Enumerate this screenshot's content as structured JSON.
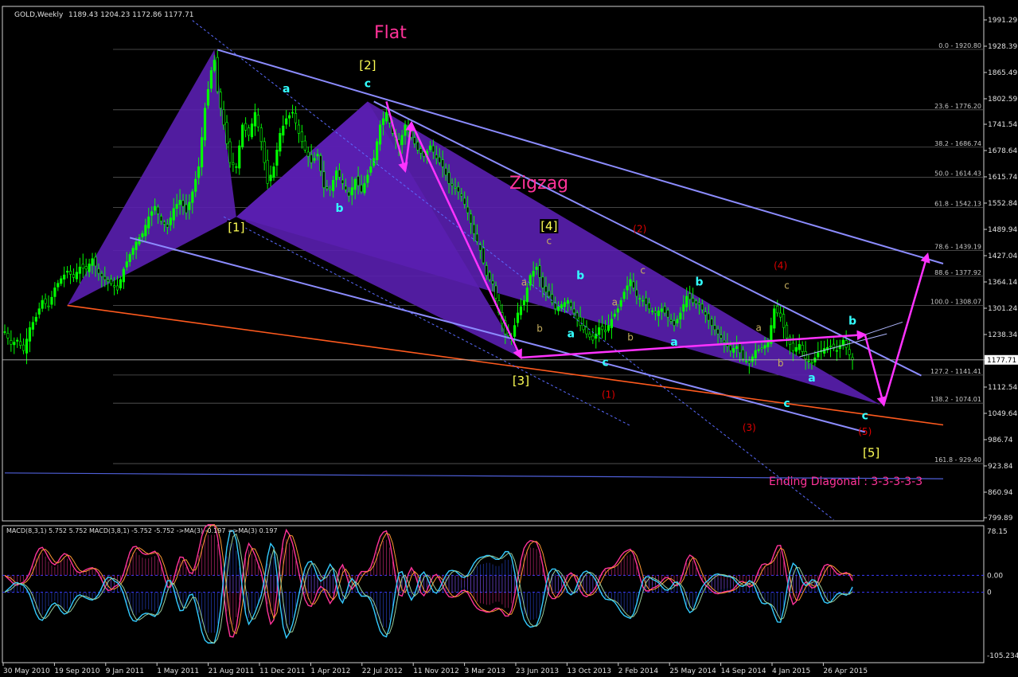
{
  "header": {
    "symbol": "GOLD,Weekly",
    "ohlc": "1189.43 1204.23 1172.86 1177.71"
  },
  "annotations": {
    "flat_title": "Flat",
    "zigzag_title": "Zigzag",
    "ending_diagonal": "Ending Diagonal : 3-3-3-3-3"
  },
  "colors": {
    "background": "#000000",
    "bull_candle": "#00ff00",
    "grid": "#5a5a5a",
    "pattern_fill": "#5a1fb0",
    "channel": "#8c8cff",
    "arrow": "#ff33ff",
    "support": "#ff5a1e",
    "label_yellow": "#ffff55",
    "label_cyan": "#33ffff",
    "label_red": "#e00000",
    "label_tan": "#c8b060",
    "macd_pink": "#ff3399",
    "macd_cyan": "#33ccff"
  },
  "chart_data": [
    {
      "type": "candlestick",
      "title": "GOLD,Weekly",
      "ylim": [
        799.89,
        1991.29
      ],
      "price_ticks": [
        "1991.29",
        "1928.39",
        "1865.49",
        "1802.59",
        "1741.54",
        "1678.64",
        "1615.74",
        "1552.84",
        "1489.94",
        "1427.04",
        "1364.14",
        "1301.24",
        "1238.34",
        "1177.71",
        "1112.54",
        "1049.64",
        "986.74",
        "923.84",
        "860.94",
        "799.89"
      ],
      "x_labels": [
        "30 May 2010",
        "19 Sep 2010",
        "9 Jan 2011",
        "1 May 2011",
        "21 Aug 2011",
        "11 Dec 2011",
        "1 Apr 2012",
        "22 Jul 2012",
        "11 Nov 2012",
        "3 Mar 2013",
        "23 Jun 2013",
        "13 Oct 2013",
        "2 Feb 2014",
        "25 May 2014",
        "14 Sep 2014",
        "4 Jan 2015",
        "26 Apr 2015"
      ],
      "last_price": "1177.71",
      "fibonacci_levels": [
        {
          "ratio": "0.0",
          "price": 1920.8,
          "label": "0.0 - 1920.80"
        },
        {
          "ratio": "23.6",
          "price": 1776.2,
          "label": "23.6 - 1776.20"
        },
        {
          "ratio": "38.2",
          "price": 1686.74,
          "label": "38.2 - 1686.74"
        },
        {
          "ratio": "50.0",
          "price": 1614.43,
          "label": "50.0 - 1614.43"
        },
        {
          "ratio": "61.8",
          "price": 1542.13,
          "label": "61.8 - 1542.13"
        },
        {
          "ratio": "78.6",
          "price": 1439.19,
          "label": "78.6 - 1439.19"
        },
        {
          "ratio": "88.6",
          "price": 1377.92,
          "label": "88.6 - 1377.92"
        },
        {
          "ratio": "100.0",
          "price": 1308.07,
          "label": "100.0 - 1308.07"
        },
        {
          "ratio": "127.2",
          "price": 1141.41,
          "label": "127.2 - 1141.41"
        },
        {
          "ratio": "138.2",
          "price": 1074.01,
          "label": "138.2 - 1074.01"
        },
        {
          "ratio": "161.8",
          "price": 929.4,
          "label": "161.8 - 929.40"
        }
      ],
      "wave_labels": [
        {
          "text": "[1]",
          "week": 74,
          "price": 1485,
          "color": "yellow"
        },
        {
          "text": "[2]",
          "week": 116,
          "price": 1873,
          "color": "yellow"
        },
        {
          "text": "[3]",
          "week": 165,
          "price": 1118,
          "color": "yellow"
        },
        {
          "text": "[4]",
          "week": 174,
          "price": 1488,
          "color": "yellow"
        },
        {
          "text": "[5]",
          "week": 277,
          "price": 946,
          "color": "yellow"
        },
        {
          "text": "a",
          "week": 90,
          "price": 1818,
          "color": "cyan"
        },
        {
          "text": "b",
          "week": 107,
          "price": 1532,
          "color": "cyan"
        },
        {
          "text": "c",
          "week": 116,
          "price": 1830,
          "color": "cyan"
        },
        {
          "text": "a",
          "week": 166,
          "price": 1356,
          "color": "tan"
        },
        {
          "text": "b",
          "week": 171,
          "price": 1245,
          "color": "tan"
        },
        {
          "text": "c",
          "week": 174,
          "price": 1455,
          "color": "tan"
        },
        {
          "text": "a",
          "week": 181,
          "price": 1232,
          "color": "cyan"
        },
        {
          "text": "b",
          "week": 184,
          "price": 1371,
          "color": "cyan"
        },
        {
          "text": "c",
          "week": 192,
          "price": 1163,
          "color": "cyan"
        },
        {
          "text": "a",
          "week": 195,
          "price": 1308,
          "color": "tan"
        },
        {
          "text": "b",
          "week": 200,
          "price": 1224,
          "color": "tan"
        },
        {
          "text": "c",
          "week": 204,
          "price": 1384,
          "color": "tan"
        },
        {
          "text": "a",
          "week": 214,
          "price": 1212,
          "color": "cyan"
        },
        {
          "text": "b",
          "week": 222,
          "price": 1356,
          "color": "cyan"
        },
        {
          "text": "a",
          "week": 241,
          "price": 1247,
          "color": "tan"
        },
        {
          "text": "b",
          "week": 248,
          "price": 1162,
          "color": "tan"
        },
        {
          "text": "c",
          "week": 250,
          "price": 1065,
          "color": "cyan"
        },
        {
          "text": "c",
          "week": 250,
          "price": 1348,
          "color": "tan"
        },
        {
          "text": "a",
          "week": 258,
          "price": 1126,
          "color": "cyan"
        },
        {
          "text": "b",
          "week": 271,
          "price": 1262,
          "color": "cyan"
        },
        {
          "text": "c",
          "week": 275,
          "price": 1035,
          "color": "cyan"
        },
        {
          "text": "(1)",
          "week": 193,
          "price": 1087,
          "color": "red"
        },
        {
          "text": "(2)",
          "week": 203,
          "price": 1483,
          "color": "red"
        },
        {
          "text": "(3)",
          "week": 238,
          "price": 1008,
          "color": "red"
        },
        {
          "text": "(4)",
          "week": 248,
          "price": 1396,
          "color": "red"
        },
        {
          "text": "(5)",
          "week": 275,
          "price": 998,
          "color": "red"
        }
      ],
      "price_path": [
        [
          0,
          1245
        ],
        [
          2,
          1215
        ],
        [
          4,
          1225
        ],
        [
          6,
          1200
        ],
        [
          8,
          1255
        ],
        [
          10,
          1280
        ],
        [
          12,
          1320
        ],
        [
          14,
          1305
        ],
        [
          16,
          1350
        ],
        [
          18,
          1372
        ],
        [
          20,
          1390
        ],
        [
          22,
          1375
        ],
        [
          24,
          1400
        ],
        [
          26,
          1395
        ],
        [
          28,
          1420
        ],
        [
          30,
          1385
        ],
        [
          32,
          1370
        ],
        [
          34,
          1360
        ],
        [
          36,
          1345
        ],
        [
          38,
          1395
        ],
        [
          40,
          1430
        ],
        [
          42,
          1460
        ],
        [
          44,
          1480
        ],
        [
          46,
          1520
        ],
        [
          48,
          1545
        ],
        [
          50,
          1510
        ],
        [
          52,
          1495
        ],
        [
          54,
          1540
        ],
        [
          56,
          1560
        ],
        [
          58,
          1530
        ],
        [
          60,
          1580
        ],
        [
          62,
          1640
        ],
        [
          64,
          1780
        ],
        [
          66,
          1870
        ],
        [
          67,
          1895
        ],
        [
          68,
          1820
        ],
        [
          70,
          1740
        ],
        [
          72,
          1650
        ],
        [
          74,
          1640
        ],
        [
          76,
          1740
        ],
        [
          78,
          1715
        ],
        [
          80,
          1770
        ],
        [
          82,
          1700
        ],
        [
          84,
          1600
        ],
        [
          86,
          1640
        ],
        [
          88,
          1720
        ],
        [
          90,
          1755
        ],
        [
          92,
          1770
        ],
        [
          94,
          1720
        ],
        [
          96,
          1680
        ],
        [
          98,
          1650
        ],
        [
          100,
          1670
        ],
        [
          102,
          1590
        ],
        [
          104,
          1585
        ],
        [
          106,
          1630
        ],
        [
          108,
          1600
        ],
        [
          110,
          1570
        ],
        [
          112,
          1610
        ],
        [
          114,
          1580
        ],
        [
          116,
          1620
        ],
        [
          118,
          1660
        ],
        [
          120,
          1740
        ],
        [
          122,
          1770
        ],
        [
          124,
          1720
        ],
        [
          126,
          1690
        ],
        [
          128,
          1740
        ],
        [
          130,
          1710
        ],
        [
          132,
          1680
        ],
        [
          134,
          1665
        ],
        [
          136,
          1690
        ],
        [
          138,
          1660
        ],
        [
          140,
          1640
        ],
        [
          142,
          1600
        ],
        [
          144,
          1590
        ],
        [
          146,
          1570
        ],
        [
          148,
          1530
        ],
        [
          150,
          1480
        ],
        [
          152,
          1440
        ],
        [
          154,
          1380
        ],
        [
          156,
          1360
        ],
        [
          158,
          1290
        ],
        [
          160,
          1240
        ],
        [
          162,
          1230
        ],
        [
          164,
          1290
        ],
        [
          166,
          1320
        ],
        [
          168,
          1380
        ],
        [
          170,
          1400
        ],
        [
          172,
          1350
        ],
        [
          174,
          1330
        ],
        [
          176,
          1300
        ],
        [
          178,
          1310
        ],
        [
          180,
          1320
        ],
        [
          182,
          1290
        ],
        [
          184,
          1260
        ],
        [
          186,
          1240
        ],
        [
          188,
          1225
        ],
        [
          190,
          1255
        ],
        [
          192,
          1245
        ],
        [
          194,
          1275
        ],
        [
          196,
          1300
        ],
        [
          198,
          1340
        ],
        [
          200,
          1370
        ],
        [
          202,
          1330
        ],
        [
          204,
          1320
        ],
        [
          206,
          1300
        ],
        [
          208,
          1290
        ],
        [
          210,
          1300
        ],
        [
          212,
          1280
        ],
        [
          214,
          1260
        ],
        [
          216,
          1290
        ],
        [
          218,
          1330
        ],
        [
          220,
          1315
        ],
        [
          222,
          1310
        ],
        [
          224,
          1285
        ],
        [
          226,
          1260
        ],
        [
          228,
          1240
        ],
        [
          230,
          1220
        ],
        [
          232,
          1200
        ],
        [
          234,
          1210
        ],
        [
          236,
          1180
        ],
        [
          238,
          1170
        ],
        [
          240,
          1200
        ],
        [
          242,
          1205
        ],
        [
          244,
          1220
        ],
        [
          246,
          1300
        ],
        [
          248,
          1280
        ],
        [
          250,
          1230
        ],
        [
          252,
          1200
        ],
        [
          254,
          1215
        ],
        [
          256,
          1180
        ],
        [
          258,
          1170
        ],
        [
          260,
          1195
        ],
        [
          262,
          1205
        ],
        [
          264,
          1210
        ],
        [
          266,
          1200
        ],
        [
          268,
          1225
        ],
        [
          270,
          1190
        ],
        [
          271,
          1178
        ]
      ],
      "price_pattern": {
        "flat_triangle": [
          [
            20,
            1308
          ],
          [
            67,
            1920
          ],
          [
            74,
            1520
          ]
        ],
        "flat_zigzag": [
          [
            74,
            1520
          ],
          [
            116,
            1796
          ],
          [
            165,
            1183
          ]
        ],
        "zigzag_body": [
          [
            116,
            1796
          ],
          [
            280,
            1070
          ],
          [
            74,
            1520
          ]
        ]
      },
      "arrows": [
        [
          [
            122,
            1796
          ],
          [
            128,
            1630
          ]
        ],
        [
          [
            128,
            1630
          ],
          [
            130,
            1745
          ]
        ],
        [
          [
            130,
            1745
          ],
          [
            165,
            1183
          ]
        ],
        [
          [
            165,
            1183
          ],
          [
            275,
            1238
          ]
        ],
        [
          [
            275,
            1238
          ],
          [
            281,
            1070
          ]
        ],
        [
          [
            281,
            1070
          ],
          [
            295,
            1430
          ]
        ]
      ],
      "lines": [
        {
          "style": "channel-solid",
          "from": [
            68,
            1920
          ],
          "to": [
            300,
            1408
          ]
        },
        {
          "style": "channel-solid",
          "from": [
            118,
            1796
          ],
          "to": [
            293,
            1140
          ]
        },
        {
          "style": "channel-solid",
          "from": [
            40,
            1470
          ],
          "to": [
            275,
            1005
          ]
        },
        {
          "style": "support",
          "from": [
            20,
            1308
          ],
          "to": [
            300,
            1022
          ]
        },
        {
          "style": "dashed",
          "from": [
            60,
            1990
          ],
          "to": [
            265,
            795
          ]
        },
        {
          "style": "dashed",
          "from": [
            70,
            1520
          ],
          "to": [
            200,
            1020
          ]
        },
        {
          "style": "thin",
          "from": [
            254,
            1185
          ],
          "to": [
            282,
            1240
          ]
        },
        {
          "style": "thin",
          "from": [
            275,
            1238
          ],
          "to": [
            287,
            1268
          ]
        },
        {
          "style": "horizontal",
          "from": [
            0,
            907
          ],
          "to": [
            300,
            893
          ]
        }
      ]
    },
    {
      "type": "line",
      "title": "MACD(8,3,1) 5.752 5.752   MACD(3,8,1) -5.752 -5.752   ->MA(3) -0.197   =>MA(3) 0.197",
      "ylim": [
        -105.234,
        78.15
      ],
      "y_ticks": [
        "78.15",
        "0.00",
        "0",
        "-105.234"
      ],
      "series": [
        {
          "name": "MACD(8,3,1)",
          "color": "pink",
          "values": []
        },
        {
          "name": "MACD(3,8,1)",
          "color": "cyan",
          "values": []
        }
      ]
    }
  ]
}
